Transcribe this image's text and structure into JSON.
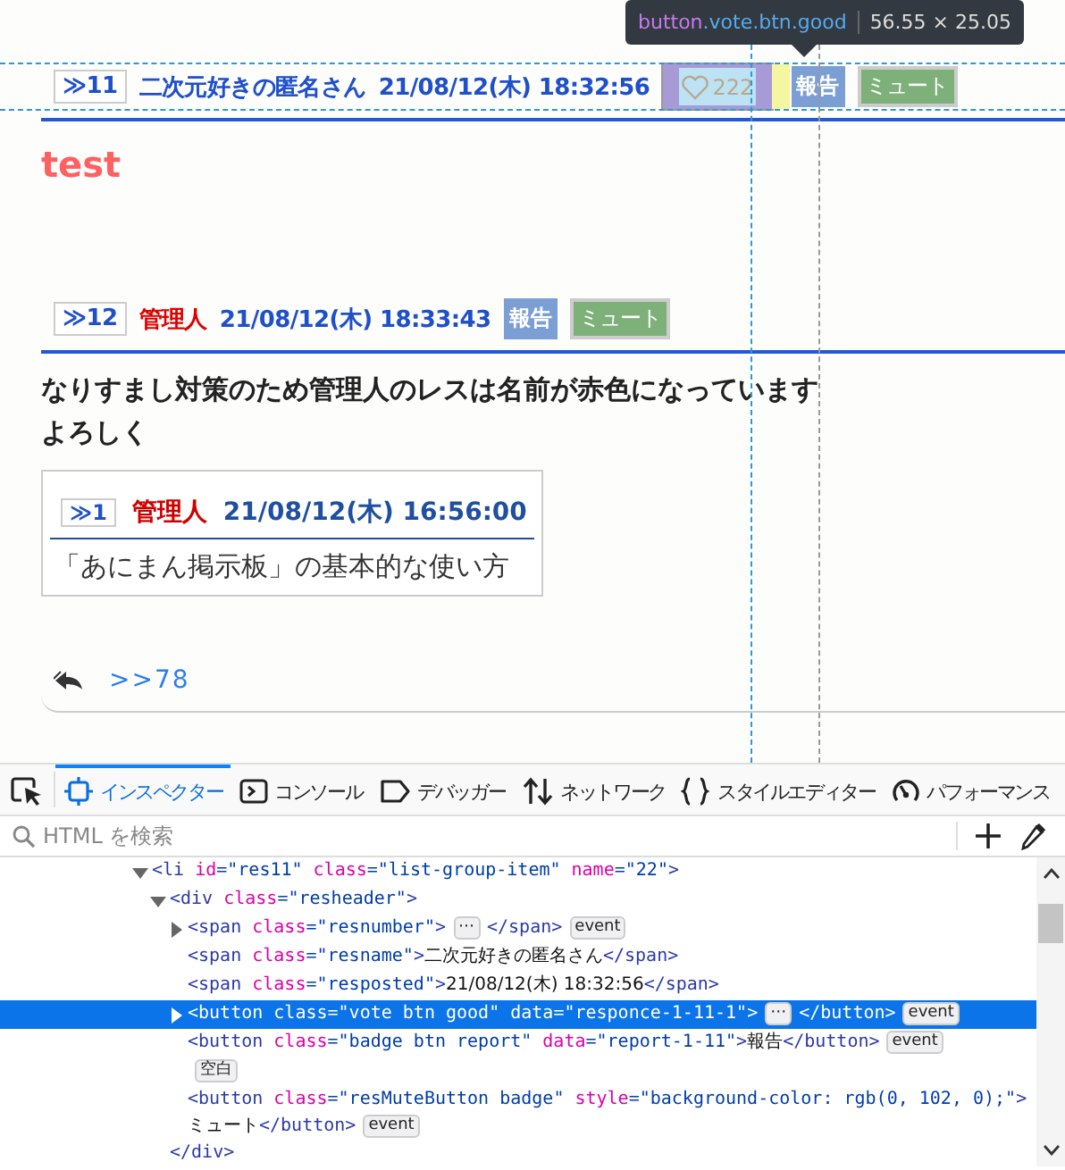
{
  "tooltip": {
    "element": "button",
    "classes": ".vote.btn.good",
    "size": "56.55 × 25.05"
  },
  "posts": [
    {
      "number": "≫11",
      "name": {
        "text": "二次元好きの匿名さん",
        "color": "#1f4fc9"
      },
      "posted": "21/08/12(木) 18:32:56",
      "vote": {
        "count": "222",
        "inspected": true
      },
      "report": "報告",
      "mute": "ミュート",
      "body": [
        {
          "kind": "heading",
          "text": "test",
          "color": "#ff6060"
        }
      ]
    },
    {
      "number": "≫12",
      "name": {
        "text": "管理人",
        "color": "#e00000"
      },
      "posted": "21/08/12(木) 18:33:43",
      "report": "報告",
      "mute": "ミュート",
      "body": [
        {
          "kind": "para",
          "lines": [
            "なりすまし対策のため管理人のレスは名前が赤色になっています",
            "よろしく"
          ]
        },
        {
          "kind": "quote",
          "number": "≫1",
          "name": {
            "text": "管理人",
            "color": "#d00000"
          },
          "posted": "21/08/12(木) 16:56:00",
          "text": "「あにまん掲示板」の基本的な使い方"
        },
        {
          "kind": "replies",
          "link": ">>78"
        }
      ]
    }
  ],
  "devtools": {
    "tabs": [
      {
        "label": "インスペクター",
        "selected": true
      },
      {
        "label": "コンソール",
        "selected": false
      },
      {
        "label": "デバッガー",
        "selected": false
      },
      {
        "label": "ネットワーク",
        "selected": false
      },
      {
        "label": "スタイルエディター",
        "selected": false
      },
      {
        "label": "パフォーマンス",
        "selected": false
      }
    ],
    "search": {
      "placeholder": "HTML を検索"
    },
    "tree": [
      {
        "kind": "parent",
        "expanded": true,
        "selected": false,
        "tokens": [
          {
            "kind": "tag",
            "text": "<li"
          },
          {
            "kind": "attr",
            "text": "id"
          },
          {
            "kind": "val",
            "text": "=\"res11\""
          },
          {
            "kind": "attr",
            "text": "class"
          },
          {
            "kind": "val",
            "text": "=\"list-group-item\""
          },
          {
            "kind": "attr",
            "text": "name"
          },
          {
            "kind": "val",
            "text": "=\"22\""
          },
          {
            "kind": "tag",
            "text": ">"
          }
        ],
        "children": [
          {
            "kind": "parent",
            "expanded": true,
            "selected": false,
            "close": "</div>",
            "tokens": [
              {
                "kind": "tag",
                "text": "<div"
              },
              {
                "kind": "attr",
                "text": "class"
              },
              {
                "kind": "val",
                "text": "=\"resheader\""
              },
              {
                "kind": "tag",
                "text": ">"
              }
            ],
            "children": [
              {
                "kind": "parent",
                "expanded": false,
                "selected": false,
                "tokens": [
                  {
                    "kind": "tag",
                    "text": "<span"
                  },
                  {
                    "kind": "attr",
                    "text": "class"
                  },
                  {
                    "kind": "val",
                    "text": "=\"resnumber\""
                  },
                  {
                    "kind": "tag",
                    "text": ">"
                  },
                  {
                    "kind": "badge",
                    "text": "⋯"
                  },
                  {
                    "kind": "tag",
                    "text": "</span>"
                  },
                  {
                    "kind": "badge",
                    "text": "event"
                  }
                ]
              },
              {
                "kind": "leaf",
                "selected": false,
                "tokens": [
                  {
                    "kind": "tag",
                    "text": "<span"
                  },
                  {
                    "kind": "attr",
                    "text": "class"
                  },
                  {
                    "kind": "val",
                    "text": "=\"resname\""
                  },
                  {
                    "kind": "tag",
                    "text": ">"
                  },
                  {
                    "kind": "text",
                    "text": "二次元好きの匿名さん"
                  },
                  {
                    "kind": "tag",
                    "text": "</span>"
                  }
                ]
              },
              {
                "kind": "leaf",
                "selected": false,
                "tokens": [
                  {
                    "kind": "tag",
                    "text": "<span"
                  },
                  {
                    "kind": "attr",
                    "text": "class"
                  },
                  {
                    "kind": "val",
                    "text": "=\"resposted\""
                  },
                  {
                    "kind": "tag",
                    "text": ">"
                  },
                  {
                    "kind": "text",
                    "text": "21/08/12(木) 18:32:56"
                  },
                  {
                    "kind": "tag",
                    "text": "</span>"
                  }
                ]
              },
              {
                "kind": "parent",
                "expanded": false,
                "selected": true,
                "tokens": [
                  {
                    "kind": "tag",
                    "text": "<button"
                  },
                  {
                    "kind": "attr",
                    "text": "class"
                  },
                  {
                    "kind": "val",
                    "text": "=\"vote btn good\""
                  },
                  {
                    "kind": "attr",
                    "text": "data"
                  },
                  {
                    "kind": "val",
                    "text": "=\"responce-1-11-1\""
                  },
                  {
                    "kind": "tag",
                    "text": ">"
                  },
                  {
                    "kind": "badge",
                    "text": "⋯"
                  },
                  {
                    "kind": "tag",
                    "text": "</button>"
                  },
                  {
                    "kind": "badge",
                    "text": "event"
                  }
                ]
              },
              {
                "kind": "leaf",
                "selected": false,
                "tokens": [
                  {
                    "kind": "tag",
                    "text": "<button"
                  },
                  {
                    "kind": "attr",
                    "text": "class"
                  },
                  {
                    "kind": "val",
                    "text": "=\"badge btn report\""
                  },
                  {
                    "kind": "attr",
                    "text": "data"
                  },
                  {
                    "kind": "val",
                    "text": "=\"report-1-11\""
                  },
                  {
                    "kind": "tag",
                    "text": ">"
                  },
                  {
                    "kind": "text",
                    "text": "報告"
                  },
                  {
                    "kind": "tag",
                    "text": "</button>"
                  },
                  {
                    "kind": "badge",
                    "text": "event"
                  }
                ]
              },
              {
                "kind": "leaf",
                "selected": false,
                "tokens": [
                  {
                    "kind": "badge",
                    "text": "空白"
                  }
                ]
              },
              {
                "kind": "leaf",
                "selected": false,
                "tokens": [
                  {
                    "kind": "tag",
                    "text": "<button"
                  },
                  {
                    "kind": "attr",
                    "text": "class"
                  },
                  {
                    "kind": "val",
                    "text": "=\"resMuteButton badge\""
                  },
                  {
                    "kind": "attr",
                    "text": "style"
                  },
                  {
                    "kind": "val",
                    "text": "=\"background-color: rgb(0, 102, 0);\""
                  },
                  {
                    "kind": "tag",
                    "text": ">"
                  },
                  {
                    "kind": "text",
                    "text": "ミュート"
                  },
                  {
                    "kind": "tag",
                    "text": "</button>"
                  },
                  {
                    "kind": "badge",
                    "text": "event"
                  }
                ]
              }
            ]
          }
        ]
      }
    ]
  }
}
